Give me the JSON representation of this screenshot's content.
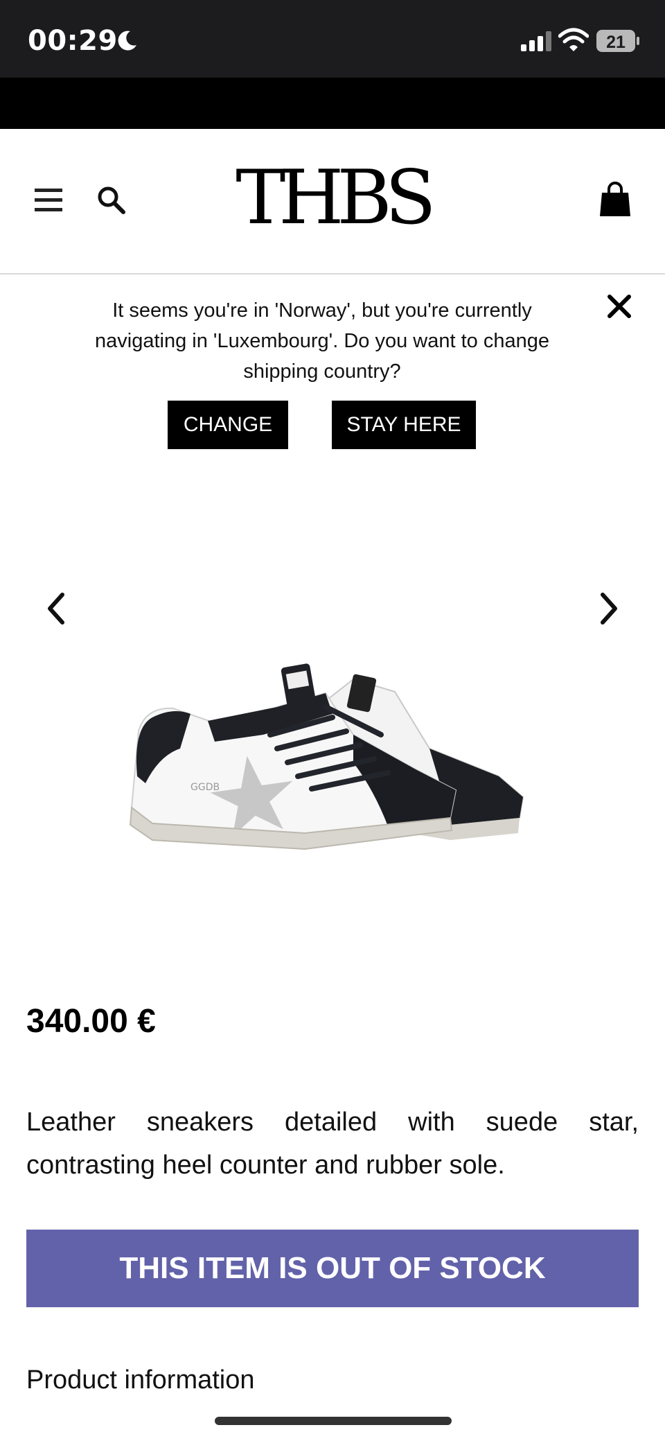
{
  "status_bar": {
    "time": "00:29",
    "battery": "21",
    "icons": [
      "moon-icon",
      "signal-icon",
      "wifi-icon",
      "battery-icon"
    ]
  },
  "header": {
    "logo": "THBS",
    "icons": [
      "menu-icon",
      "search-icon",
      "bag-icon"
    ]
  },
  "country_banner": {
    "message": "It seems you're in 'Norway', but you're currently navigating in 'Luxembourg'. Do you want to change shipping country?",
    "change_label": "CHANGE",
    "stay_label": "STAY HERE",
    "close_icon": "close-icon"
  },
  "gallery": {
    "prev_icon": "chevron-left-icon",
    "next_icon": "chevron-right-icon"
  },
  "product": {
    "price": "340.00 €",
    "description": "Leather sneakers detailed with suede star, contrasting heel counter and rubber sole.",
    "stock_status": "THIS ITEM IS OUT OF STOCK",
    "info_heading": "Product information"
  },
  "colors": {
    "status_bar": "#1c1c1e",
    "accent_out_of_stock": "#6262aa",
    "button_bg": "#000000"
  }
}
